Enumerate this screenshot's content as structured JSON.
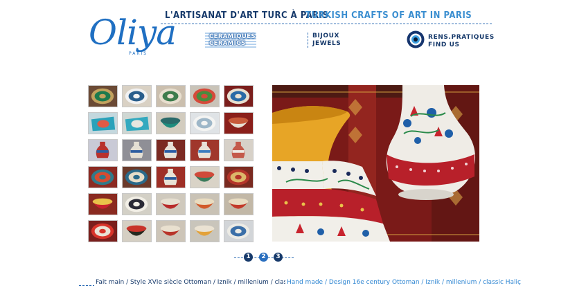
{
  "brand": {
    "logo_script": "Oliya",
    "logo_city": "PARIS"
  },
  "header": {
    "tagline_fr": "L'ARTISANAT D'ART TURC À PARIS",
    "tagline_en": "TURKISH CRAFTS OF ART IN PARIS"
  },
  "nav": {
    "ceramics": {
      "line1": "CERAMIQUES",
      "line2": "CERAMICS"
    },
    "jewels": {
      "line1": "BIJOUX",
      "line2": "JEWELS"
    },
    "info": {
      "line1": "RENS.PRATIQUES",
      "line2": "FIND US",
      "icon": "evil-eye-icon"
    }
  },
  "gallery": {
    "columns": 5,
    "rows": 6,
    "thumbnails": [
      {
        "kind": "plate",
        "bg": "#6b4a35",
        "c1": "#1c7a4d",
        "c2": "#c2a25e"
      },
      {
        "kind": "plate",
        "bg": "#d9d1c4",
        "c1": "#2a5e8c",
        "c2": "#f2f2f2"
      },
      {
        "kind": "plate",
        "bg": "#cbbfae",
        "c1": "#3d7c4c",
        "c2": "#e8dfcf"
      },
      {
        "kind": "plate",
        "bg": "#c9c3b8",
        "c1": "#4a8b3e",
        "c2": "#d54a3a"
      },
      {
        "kind": "plate",
        "bg": "#7b1e1c",
        "c1": "#2a6aa6",
        "c2": "#e8e0d0"
      },
      {
        "kind": "tray",
        "bg": "#c4d8de",
        "c1": "#2aa2ba",
        "c2": "#e05a45"
      },
      {
        "kind": "tray",
        "bg": "#cfd7d3",
        "c1": "#33a9bf",
        "c2": "#e8e6df"
      },
      {
        "kind": "bowl",
        "bg": "#d2ccbf",
        "c1": "#1e8c7e",
        "c2": "#2a6a6a"
      },
      {
        "kind": "plate",
        "bg": "#dfe3e6",
        "c1": "#9eb7c8",
        "c2": "#f4f4f2"
      },
      {
        "kind": "bowl",
        "bg": "#8a1f1a",
        "c1": "#e7dfd2",
        "c2": "#c85a3a"
      },
      {
        "kind": "vase",
        "bg": "#c9cad6",
        "c1": "#b8322e",
        "c2": "#2d5da0"
      },
      {
        "kind": "vase",
        "bg": "#8f8f96",
        "c1": "#e4dfd3",
        "c2": "#2d5da0"
      },
      {
        "kind": "vase",
        "bg": "#7b2a22",
        "c1": "#e6e1d8",
        "c2": "#2a5da6"
      },
      {
        "kind": "vase",
        "bg": "#a0372c",
        "c1": "#e8e2d8",
        "c2": "#3b7dc0"
      },
      {
        "kind": "vase",
        "bg": "#d7d1c8",
        "c1": "#c45a4a",
        "c2": "#eeeae3"
      },
      {
        "kind": "plate",
        "bg": "#8b2a22",
        "c1": "#d64b30",
        "c2": "#2f7a8a"
      },
      {
        "kind": "plate",
        "bg": "#6b3a2a",
        "c1": "#e6ddc8",
        "c2": "#2a6a8a"
      },
      {
        "kind": "vase",
        "bg": "#9e2f26",
        "c1": "#e8e2d5",
        "c2": "#2a5a9a"
      },
      {
        "kind": "bowl",
        "bg": "#d9d3c7",
        "c1": "#3a7a5a",
        "c2": "#d04a3a"
      },
      {
        "kind": "plate",
        "bg": "#7a2a20",
        "c1": "#dcb86a",
        "c2": "#b4352a"
      },
      {
        "kind": "bowl",
        "bg": "#8a2a20",
        "c1": "#c9202f",
        "c2": "#e9c24a"
      },
      {
        "kind": "plate",
        "bg": "#d3d0c6",
        "c1": "#2a2a36",
        "c2": "#f2efe6"
      },
      {
        "kind": "bowl",
        "bg": "#cfc9bd",
        "c1": "#b82a2a",
        "c2": "#e6dfd0"
      },
      {
        "kind": "bowl",
        "bg": "#c9c2b5",
        "c1": "#d25a2a",
        "c2": "#e9dcc0"
      },
      {
        "kind": "bowl",
        "bg": "#c2b8a7",
        "c1": "#c23a2a",
        "c2": "#e8dcc2"
      },
      {
        "kind": "plate",
        "bg": "#7a1f1c",
        "c1": "#e9e3d5",
        "c2": "#d8342a"
      },
      {
        "kind": "bowl",
        "bg": "#d5cfc3",
        "c1": "#25291f",
        "c2": "#c8332a"
      },
      {
        "kind": "bowl",
        "bg": "#cdc5b8",
        "c1": "#b8352a",
        "c2": "#e9e0cf"
      },
      {
        "kind": "bowl",
        "bg": "#c9c5bb",
        "c1": "#e3a23a",
        "c2": "#eae2d2"
      },
      {
        "kind": "plate",
        "bg": "#d2d5d8",
        "c1": "#3b6fa8",
        "c2": "#ecebe5"
      }
    ]
  },
  "main_photo": {
    "subject": "two painted iznik vases on a kilim background"
  },
  "pagination": {
    "pages": [
      "1",
      "2",
      "3"
    ],
    "current": "1"
  },
  "footer": {
    "caption_fr": "Fait main / Style XVIe siècle Ottoman / Iznik / millenium / classique Haliç",
    "caption_en": "Hand made / Design 16e century Ottoman /  Iznik / millenium / classic Haliç"
  },
  "colors": {
    "navy": "#173a6b",
    "accent_blue": "#3a8ed0",
    "logo_blue": "#1f6fc2"
  }
}
